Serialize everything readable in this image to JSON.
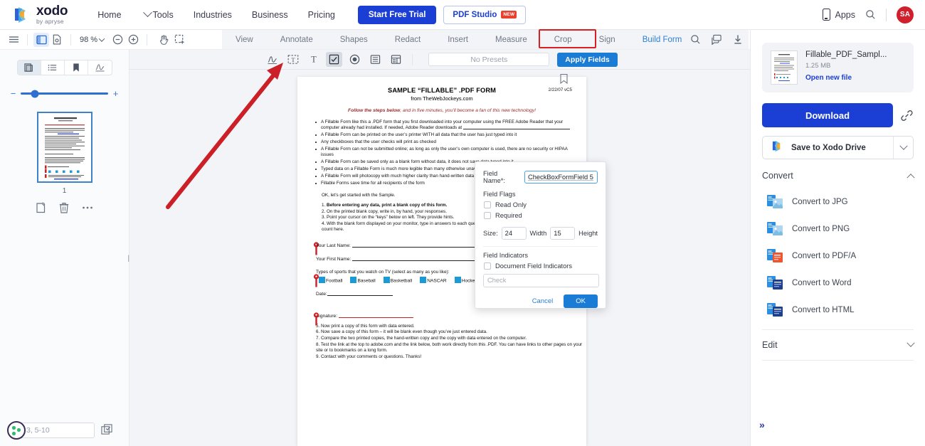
{
  "topnav": {
    "brand_name": "xodo",
    "brand_sub": "by apryse",
    "links": [
      {
        "label": "Home",
        "caret": false
      },
      {
        "label": "Tools",
        "caret": true
      },
      {
        "label": "Industries",
        "caret": false
      },
      {
        "label": "Business",
        "caret": false
      },
      {
        "label": "Pricing",
        "caret": false
      }
    ],
    "trial_button": "Start Free Trial",
    "studio_button": "PDF Studio",
    "studio_badge": "NEW",
    "apps_label": "Apps",
    "avatar_initials": "SA",
    "accent_blue": "#1b3fd4",
    "avatar_color": "#d0202e"
  },
  "toolbar": {
    "zoom_level": "98 %",
    "tabs": [
      {
        "label": "View",
        "active": false
      },
      {
        "label": "Annotate",
        "active": false
      },
      {
        "label": "Shapes",
        "active": false
      },
      {
        "label": "Redact",
        "active": false
      },
      {
        "label": "Insert",
        "active": false
      },
      {
        "label": "Measure",
        "active": false
      },
      {
        "label": "Crop",
        "active": false
      },
      {
        "label": "Sign",
        "active": false
      },
      {
        "label": "Build Form",
        "active": true
      }
    ],
    "highlight_color": "#d81f22"
  },
  "formtools": {
    "presets_placeholder": "No Presets",
    "apply_label": "Apply Fields",
    "tools": [
      {
        "name": "signature-field-tool",
        "active": false
      },
      {
        "name": "text-field-tool",
        "active": false
      },
      {
        "name": "free-text-tool",
        "active": false
      },
      {
        "name": "checkbox-field-tool",
        "active": true
      },
      {
        "name": "radio-button-field-tool",
        "active": false
      },
      {
        "name": "list-box-field-tool",
        "active": false
      },
      {
        "name": "combo-box-field-tool",
        "active": false
      }
    ]
  },
  "leftpanel": {
    "tabs": [
      "thumbnails",
      "outline",
      "bookmarks",
      "signatures"
    ],
    "page_number": "1",
    "page_range_placeholder": "3, 5-10"
  },
  "dialog": {
    "field_name_label": "Field Name*:",
    "field_name_value": "CheckBoxFormField 5",
    "field_flags_label": "Field Flags",
    "read_only_label": "Read Only",
    "required_label": "Required",
    "size_label": "Size:",
    "size_value": "24",
    "width_label": "Width",
    "width_value": "15",
    "height_label": "Height",
    "field_indicators_label": "Field Indicators",
    "doc_field_indicators_label": "Document Field Indicators",
    "check_placeholder": "Check",
    "cancel_label": "Cancel",
    "ok_label": "OK"
  },
  "rightpanel": {
    "file_name": "Fillable_PDF_Sampl...",
    "file_size": "1.25 MB",
    "open_new_file": "Open new file",
    "download_label": "Download",
    "save_drive_label": "Save to Xodo Drive",
    "convert_title": "Convert",
    "convert_items": [
      {
        "label": "Convert to JPG",
        "accent": "#9fc9e8"
      },
      {
        "label": "Convert to PNG",
        "accent": "#9fc9e8"
      },
      {
        "label": "Convert to PDF/A",
        "accent": "#f0552f"
      },
      {
        "label": "Convert to Word",
        "accent": "#1d3f8f"
      },
      {
        "label": "Convert to HTML",
        "accent": "#1d3f8f"
      }
    ],
    "edit_title": "Edit",
    "collapse_label": "»"
  },
  "document": {
    "title": "SAMPLE “FILLABLE” .PDF FORM",
    "subtitle": "from TheWebJockeys.com",
    "version": "2/22/07 vC5",
    "follow_bold": "Follow the steps below",
    "follow_rest": ", and in five minutes, you’ll become a fan of this new technology!",
    "bullets": [
      "A Fillable Form like this a .PDF form that you first downloaded into your computer using the FREE Adobe Reader that your computer already had installed. If needed, Adobe Reader downloads at",
      "A Fillable Form can be printed on the user’s printer WITH all data that the user has just typed into it",
      "Any checkboxes that the user checks will print as checked",
      "A Fillable Form can not be submitted online; as long as only the user’s own computer is used, there are no security or HIPAA issues",
      "A Fillable Form can be saved only as a blank form without data, it does not save data typed into it",
      "Typed data on a Fillable Form is much more legible than many otherwise unavoidable errors",
      "A Fillable Form will photocopy with much higher clarity than hand-written data",
      "Fillable Forms save time for all recipients of the form"
    ],
    "ok_line": "OK, let’s get started with the Sample.",
    "steps": [
      {
        "num": "1.",
        "bold": "Before entering any data, print a blank copy of this form.",
        "rest": ""
      },
      {
        "num": "2.",
        "bold": "",
        "rest": "On the printed blank copy, write in, by hand, your responses."
      },
      {
        "num": "3.",
        "bold": "",
        "rest": "Point your cursor on the “keys” below on left. They provide hints."
      },
      {
        "num": "4.",
        "bold": "",
        "rest": "With the blank form displayed on your monitor, type in answers to each question. Don’t worry, accuracy and spelling don’t count here."
      }
    ],
    "last_name_label": "Your Last Name:",
    "first_name_label": "Your First Name:",
    "sports_label": "Types of sports that you watch on TV (select as many as you like):",
    "sports": [
      "Football",
      "Baseball",
      "Basketball",
      "NASCAR",
      "Hockey"
    ],
    "date_label": "Date:",
    "signature_label": "Signature:",
    "steps2": [
      "5. Now print a copy of this form with data entered.",
      "6. Now save a copy of this form – it will be blank even though you’ve just entered data.",
      "7. Compare the two printed copies, the hand-written copy and the copy with data entered on the computer.",
      "8. Test the link at the top to adobe.com and the link below, both work directly from this .PDF. You can have links to other pages on your site or to bookmarks on a long form.",
      "9. Contact                                     with your comments or questions.  Thanks!"
    ]
  }
}
